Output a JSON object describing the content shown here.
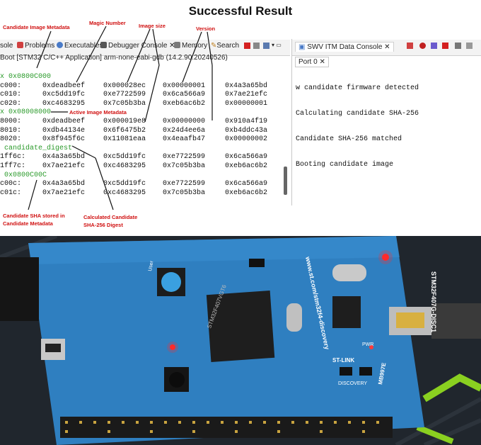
{
  "title": "Successful Result",
  "tabs": {
    "console": "sole",
    "problems": "Problems",
    "executables": "Executables",
    "debugger_console": "Debugger Console",
    "memory": "Memory",
    "search": "Search"
  },
  "subtitle": "Boot [STM32 C/C++ Application] arm-none-eabi-gdb (14.2.90.20240526)",
  "memory_lines": [
    {
      "addr": "x 0x0800C000",
      "c1": "",
      "c2": "",
      "c3": "",
      "c4": "",
      "hdr": true
    },
    {
      "addr": "c000:",
      "c1": "0xdeadbeef",
      "c2": "0x000028ec",
      "c3": "0x00000001",
      "c4": "0x4a3a65bd"
    },
    {
      "addr": "c010:",
      "c1": "0xc5dd19fc",
      "c2": "0xe7722599",
      "c3": "0x6ca566a9",
      "c4": "0x7ae21efc"
    },
    {
      "addr": "c020:",
      "c1": "0xc4683295",
      "c2": "0x7c05b3ba",
      "c3": "0xeb6ac6b2",
      "c4": "0x00000001"
    },
    {
      "addr": "x 0x08008000",
      "c1": "",
      "c2": "",
      "c3": "",
      "c4": "",
      "hdr": true
    },
    {
      "addr": "8000:",
      "c1": "0xdeadbeef",
      "c2": "0x000019e8",
      "c3": "0x00000000",
      "c4": "0x910a4f19"
    },
    {
      "addr": "8010:",
      "c1": "0xdb44134e",
      "c2": "0x6f6475b2",
      "c3": "0x24d4ee6a",
      "c4": "0xb4ddc43a"
    },
    {
      "addr": "8020:",
      "c1": "0x8f945f6c",
      "c2": "0x11081eaa",
      "c3": "0x4eaafb47",
      "c4": "0x00000002"
    },
    {
      "addr": " candidate_digest",
      "c1": "",
      "c2": "",
      "c3": "",
      "c4": "",
      "hdr": true
    },
    {
      "addr": "1ff6c:",
      "c1": "0x4a3a65bd",
      "c2": "0xc5dd19fc",
      "c3": "0xe7722599",
      "c4": "0x6ca566a9"
    },
    {
      "addr": "1ff7c:",
      "c1": "0x7ae21efc",
      "c2": "0xc4683295",
      "c3": "0x7c05b3ba",
      "c4": "0xeb6ac6b2"
    },
    {
      "addr": " 0x0800C00C",
      "c1": "",
      "c2": "",
      "c3": "",
      "c4": "",
      "hdr": true
    },
    {
      "addr": "c00c:",
      "c1": "0x4a3a65bd",
      "c2": "0xc5dd19fc",
      "c3": "0xe7722599",
      "c4": "0x6ca566a9"
    },
    {
      "addr": "c01c:",
      "c1": "0x7ae21efc",
      "c2": "0xc4683295",
      "c3": "0x7c05b3ba",
      "c4": "0xeb6ac6b2"
    }
  ],
  "swv": {
    "tab_label": "SWV ITM Data Console",
    "port_label": "Port 0",
    "lines": [
      "w candidate firmware detected",
      "Calculating candidate SHA-256",
      "Candidate SHA-256 matched",
      "Booting candidate image"
    ]
  },
  "annotations": {
    "candidate_meta": "Candidate Image Metadata",
    "magic": "Magic Number",
    "image_size": "Image size",
    "version": "Version",
    "active_meta": "Active Image Metadata",
    "cand_sha_stored": "Candidate SHA stored in Candidate Metadata",
    "calc_sha": "Calculated Candidate SHA-256 Digest"
  },
  "photo": {
    "board_label": "STM32F407G-DISC1",
    "url_text": "www.st.com/stm32f4-discovery",
    "chip_text": "STM32F407VGT6",
    "user_label": "User",
    "stlink_label": "ST-LINK",
    "discovery_label": "DISCOVERY",
    "part_code": "MB997E",
    "pwr_label": "PWR",
    "colors": {
      "pcb": "#2f7fc0",
      "led_red": "#ff2a2a",
      "button": "#3aa0e0"
    }
  }
}
